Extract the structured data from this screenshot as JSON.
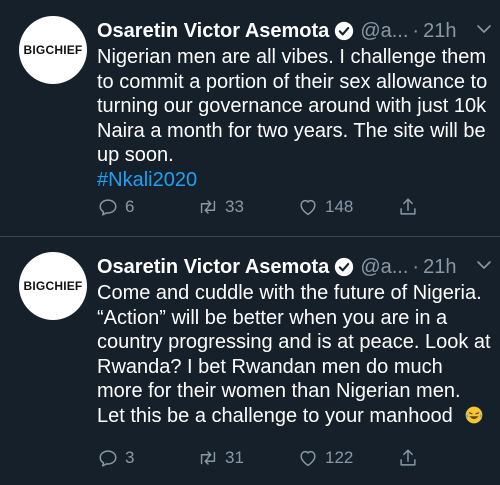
{
  "colors": {
    "background": "#15202b",
    "text": "#ffffff",
    "muted": "#8899a6",
    "link": "#1da1f2",
    "divider": "#38444d"
  },
  "tweets": [
    {
      "avatar_text": "BIGCHIEF",
      "name": "Osaretin Victor Asemota",
      "handle": "@a...",
      "separator": "·",
      "time": "21h",
      "text": "Nigerian men are all vibes. I challenge them to commit a portion of their sex allowance to turning our governance around with just 10k Naira a month for two years. The site will be up soon.",
      "hashtag": "#Nkali2020",
      "replies": "6",
      "retweets": "33",
      "likes": "148",
      "icons": [
        "verified-badge-icon",
        "chevron-down-icon",
        "reply-icon",
        "retweet-icon",
        "heart-icon",
        "share-icon"
      ]
    },
    {
      "avatar_text": "BIGCHIEF",
      "name": "Osaretin Victor Asemota",
      "handle": "@a...",
      "separator": "·",
      "time": "21h",
      "text": "Come and cuddle with the future of Nigeria. “Action” will be better when you are in a country progressing and is at peace. Look at Rwanda? I bet Rwandan men do much more for their women than Nigerian men. Let this be a challenge to your manhood",
      "emoji": "laughing-tears-emoji",
      "replies": "3",
      "retweets": "31",
      "likes": "122",
      "icons": [
        "verified-badge-icon",
        "chevron-down-icon",
        "reply-icon",
        "retweet-icon",
        "heart-icon",
        "share-icon"
      ]
    }
  ]
}
